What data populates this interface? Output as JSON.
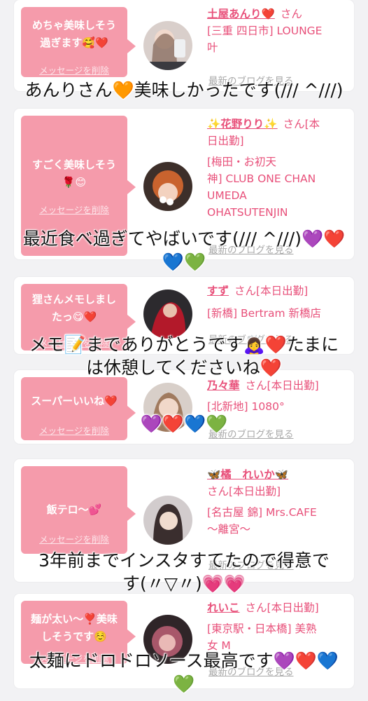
{
  "cards": [
    {
      "message_line1": "めちゃ美味しそう",
      "message_line2": "過ぎます🥰❤️",
      "delete_label": "メッセージを削除",
      "name": "土屋あんり❤️",
      "san": "さん",
      "info_lines": [
        "[三重 四日市] LOUNGE",
        "叶"
      ],
      "blog_label": "最新のブログを見る"
    },
    {
      "message_line1": "すごく美味しそう",
      "message_line2": "🌹😊",
      "delete_label": "メッセージを削除",
      "name": "✨花野りり✨",
      "san": "さん[本",
      "info_lines": [
        "日出勤]",
        "[梅田・お初天",
        "神] CLUB ONE CHAN",
        "UMEDA",
        "OHATSUTENJIN"
      ],
      "blog_label": "最新のブログを見る"
    },
    {
      "message_line1": "狸さんメモしまし",
      "message_line2": "たっ😋❤️",
      "delete_label": "メッセージを削除",
      "name": "すず",
      "san": "さん[本日出勤]",
      "info_lines": [
        "[新橋] Bertram 新橋店"
      ],
      "blog_label": "最新のブログを見る"
    },
    {
      "message_line1": "スーパーいいね❤️",
      "message_line2": "",
      "delete_label": "メッセージを削除",
      "name": "乃々華",
      "san": "さん[本日出勤]",
      "info_lines": [
        "[北新地] 1080°"
      ],
      "blog_label": "最新のブログを見る"
    },
    {
      "message_line1": "飯テロ〜💕",
      "message_line2": "",
      "delete_label": "メッセージを削除",
      "name": "🦋橘　れいか🦋",
      "san": "さん[本日出勤]",
      "info_lines": [
        "[名古屋 錦] Mrs.CAFE",
        "〜離宮〜"
      ],
      "blog_label": "最新のブログを見る"
    },
    {
      "message_line1": "麺が太い〜❣️美味",
      "message_line2": "しそうです☺️",
      "delete_label": "メッセージを削除",
      "name": "れいこ",
      "san": "さん[本日出勤]",
      "info_lines": [
        "[東京駅・日本橋] 美熟",
        "女 M"
      ],
      "blog_label": "最新のブログを見る"
    }
  ],
  "captions": [
    {
      "line1": "あんりさん🧡美味しかったです(/// ^///)",
      "line2": ""
    },
    {
      "line1": "最近食べ過ぎてやばいです(/// ^///)💜❤️",
      "line2": "💙💚"
    },
    {
      "line1": "メモ📝までありがとうです🙇‍♀️❤️たまに",
      "line2": "は休憩してくださいね❤️"
    },
    {
      "line1": "💜❤️💙💚",
      "line2": ""
    },
    {
      "line1": "3年前までインスタすてたので得意で",
      "line2": "す(〃▽〃)💗💗"
    },
    {
      "line1": "太麺にドロドロソース最高です💜❤️💙",
      "line2": "💚"
    }
  ],
  "colors": {
    "accent": "#f59bab",
    "name_text": "#e8507a",
    "link_gray": "#a9a9a9"
  }
}
